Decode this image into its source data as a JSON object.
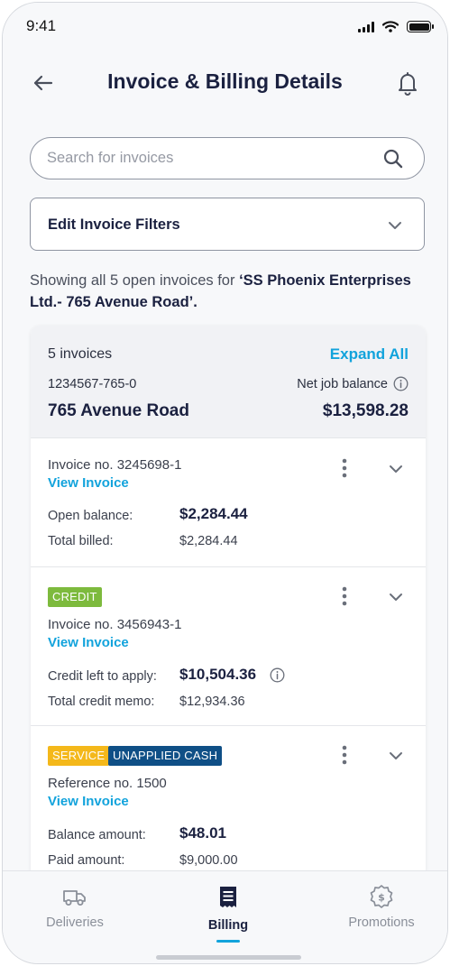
{
  "status_bar": {
    "time": "9:41"
  },
  "header": {
    "title": "Invoice & Billing Details"
  },
  "search": {
    "placeholder": "Search for invoices"
  },
  "filters": {
    "label": "Edit Invoice Filters"
  },
  "summary": {
    "prefix": "Showing all 5 open invoices for ",
    "customer": "‘SS Phoenix Enterprises Ltd.- 765 Avenue Road’."
  },
  "account": {
    "invoice_count": "5 invoices",
    "expand_all_label": "Expand All",
    "account_number": "1234567-765-0",
    "net_balance_label": "Net job balance",
    "address": "765 Avenue Road",
    "net_balance_value": "$13,598.28"
  },
  "invoices": [
    {
      "badges": [],
      "ref": "Invoice no. 3245698-1",
      "view_label": "View Invoice",
      "primary_label": "Open balance:",
      "primary_value": "$2,284.44",
      "secondary_label": "Total billed:",
      "secondary_value": "$2,284.44"
    },
    {
      "badges": [
        "CREDIT"
      ],
      "ref": "Invoice no. 3456943-1",
      "view_label": "View Invoice",
      "primary_label": "Credit left to apply:",
      "primary_value": "$10,504.36",
      "secondary_label": "Total credit memo:",
      "secondary_value": "$12,934.36"
    },
    {
      "badges": [
        "SERVICE",
        "UNAPPLIED CASH"
      ],
      "ref": "Reference no. 1500",
      "view_label": "View Invoice",
      "primary_label": "Balance amount:",
      "primary_value": "$48.01",
      "secondary_label": "Paid amount:",
      "secondary_value": "$9,000.00"
    }
  ],
  "colors": {
    "accent": "#12a3dc",
    "credit_badge": "#7dba3d",
    "service_badge": "#f4b81a",
    "unapplied_cash_badge": "#0f4f86",
    "title_text": "#1b2140"
  },
  "bottom_nav": {
    "items": [
      {
        "label": "Deliveries",
        "icon": "truck-icon",
        "active": false
      },
      {
        "label": "Billing",
        "icon": "billing-icon",
        "active": true
      },
      {
        "label": "Promotions",
        "icon": "promotions-icon",
        "active": false
      }
    ]
  }
}
